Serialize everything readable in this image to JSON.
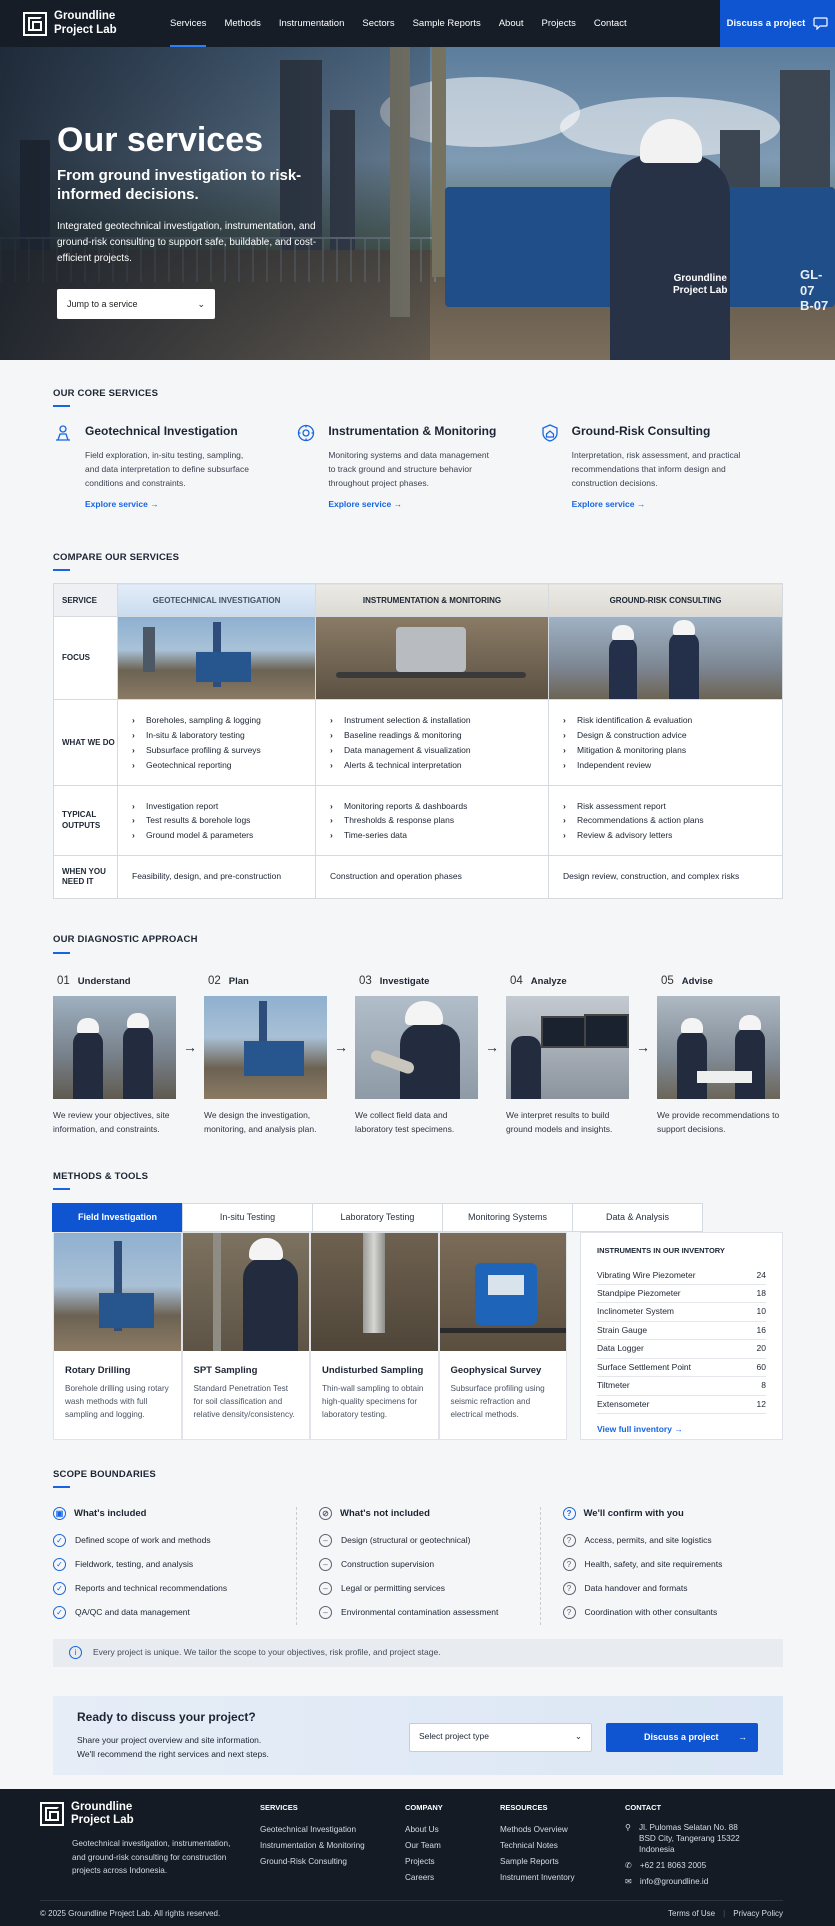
{
  "nav": {
    "brand_line1": "Groundline",
    "brand_line2": "Project Lab",
    "items": [
      "Services",
      "Methods",
      "Instrumentation",
      "Sectors",
      "Sample Reports",
      "About",
      "Projects",
      "Contact"
    ],
    "cta": "Discuss a project"
  },
  "hero": {
    "title": "Our services",
    "subtitle": "From ground investigation to risk-informed decisions.",
    "description": "Integrated geotechnical investigation, instrumentation, and ground-risk consulting to support safe, buildable, and cost-efficient projects.",
    "jump_label": "Jump to a service",
    "jacket_text_1": "Groundline",
    "jacket_text_2": "Project Lab",
    "rig_text_1": "GL-07",
    "rig_text_2": "B-07"
  },
  "core": {
    "title": "Our core services",
    "items": [
      {
        "title": "Geotechnical Investigation",
        "desc": "Field exploration, in-situ testing, sampling, and data interpretation to define subsurface conditions and constraints.",
        "link": "Explore service"
      },
      {
        "title": "Instrumentation & Monitoring",
        "desc": "Monitoring systems and data management to track ground and structure behavior throughout project phases.",
        "link": "Explore service"
      },
      {
        "title": "Ground-Risk Consulting",
        "desc": "Interpretation, risk assessment, and practical recommendations that inform design and construction decisions.",
        "link": "Explore service"
      }
    ]
  },
  "compare": {
    "title": "Compare our services",
    "head_label": "SERVICE",
    "cols": [
      "GEOTECHNICAL INVESTIGATION",
      "INSTRUMENTATION & MONITORING",
      "GROUND-RISK CONSULTING"
    ],
    "row_focus": "FOCUS",
    "row_what": "WHAT WE DO",
    "row_outputs": "TYPICAL OUTPUTS",
    "row_when": "WHEN YOU NEED IT",
    "what": [
      [
        "Boreholes, sampling & logging",
        "In-situ & laboratory testing",
        "Subsurface profiling & surveys",
        "Geotechnical reporting"
      ],
      [
        "Instrument selection & installation",
        "Baseline readings & monitoring",
        "Data management & visualization",
        "Alerts & technical interpretation"
      ],
      [
        "Risk identification & evaluation",
        "Design & construction advice",
        "Mitigation & monitoring plans",
        "Independent review"
      ]
    ],
    "outputs": [
      [
        "Investigation report",
        "Test results & borehole logs",
        "Ground model & parameters"
      ],
      [
        "Monitoring reports & dashboards",
        "Thresholds & response plans",
        "Time-series data"
      ],
      [
        "Risk assessment report",
        "Recommendations & action plans",
        "Review & advisory letters"
      ]
    ],
    "when": [
      "Feasibility, design, and pre-construction",
      "Construction and operation phases",
      "Design review, construction, and complex risks"
    ]
  },
  "diagnostic": {
    "title": "Our diagnostic approach",
    "steps": [
      {
        "num": "01",
        "label": "Understand",
        "desc": "We review your objectives, site information, and constraints."
      },
      {
        "num": "02",
        "label": "Plan",
        "desc": "We design the investigation, monitoring, and analysis plan."
      },
      {
        "num": "03",
        "label": "Investigate",
        "desc": "We collect field data and laboratory test specimens."
      },
      {
        "num": "04",
        "label": "Analyze",
        "desc": "We interpret results to build ground models and insights."
      },
      {
        "num": "05",
        "label": "Advise",
        "desc": "We provide recommendations to support decisions."
      }
    ]
  },
  "methods": {
    "title": "Methods & tools",
    "tabs": [
      "Field Investigation",
      "In-situ Testing",
      "Laboratory Testing",
      "Monitoring Systems",
      "Data & Analysis"
    ],
    "cards": [
      {
        "title": "Rotary Drilling",
        "desc": "Borehole drilling using rotary wash methods with full sampling and logging."
      },
      {
        "title": "SPT Sampling",
        "desc": "Standard Penetration Test for soil classification and relative density/consistency."
      },
      {
        "title": "Undisturbed Sampling",
        "desc": "Thin-wall sampling to obtain high-quality specimens for laboratory testing."
      },
      {
        "title": "Geophysical Survey",
        "desc": "Subsurface profiling using seismic refraction and electrical methods."
      }
    ],
    "inventory_title": "Instruments in our inventory",
    "inventory": [
      {
        "name": "Vibrating Wire Piezometer",
        "count": "24"
      },
      {
        "name": "Standpipe Piezometer",
        "count": "18"
      },
      {
        "name": "Inclinometer System",
        "count": "10"
      },
      {
        "name": "Strain Gauge",
        "count": "16"
      },
      {
        "name": "Data Logger",
        "count": "20"
      },
      {
        "name": "Surface Settlement Point",
        "count": "60"
      },
      {
        "name": "Tiltmeter",
        "count": "8"
      },
      {
        "name": "Extensometer",
        "count": "12"
      }
    ],
    "inventory_link": "View full inventory"
  },
  "scope": {
    "title": "Scope boundaries",
    "included_title": "What's included",
    "included": [
      "Defined scope of work and methods",
      "Fieldwork, testing, and analysis",
      "Reports and technical recommendations",
      "QA/QC and data management"
    ],
    "excluded_title": "What's not included",
    "excluded": [
      "Design (structural or geotechnical)",
      "Construction supervision",
      "Legal or permitting services",
      "Environmental contamination assessment"
    ],
    "confirm_title": "We'll confirm with you",
    "confirm": [
      "Access, permits, and site logistics",
      "Health, safety, and site requirements",
      "Data handover and formats",
      "Coordination with other consultants"
    ],
    "note": "Every project is unique. We tailor the scope to your objectives, risk profile, and project stage."
  },
  "cta": {
    "title": "Ready to discuss your project?",
    "line1": "Share your project overview and site information.",
    "line2": "We'll recommend the right services and next steps.",
    "select_placeholder": "Select project type",
    "button": "Discuss a project"
  },
  "footer": {
    "brand_line1": "Groundline",
    "brand_line2": "Project Lab",
    "desc": "Geotechnical investigation, instrumentation, and ground-risk consulting for construction projects across Indonesia.",
    "services_title": "Services",
    "services": [
      "Geotechnical Investigation",
      "Instrumentation & Monitoring",
      "Ground-Risk Consulting"
    ],
    "company_title": "Company",
    "company": [
      "About Us",
      "Our Team",
      "Projects",
      "Careers"
    ],
    "resources_title": "Resources",
    "resources": [
      "Methods Overview",
      "Technical Notes",
      "Sample Reports",
      "Instrument Inventory"
    ],
    "contact_title": "Contact",
    "address": "Jl. Pulomas Selatan No. 88 BSD City, Tangerang 15322 Indonesia",
    "phone": "+62 21 8063 2005",
    "email": "info@groundline.id",
    "copyright": "© 2025 Groundline Project Lab. All rights reserved.",
    "terms": "Terms of Use",
    "privacy": "Privacy Policy"
  }
}
